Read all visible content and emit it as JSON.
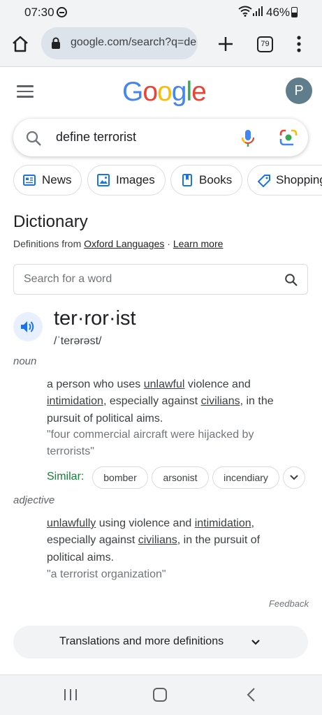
{
  "status_bar": {
    "time": "07:30",
    "battery": "46%",
    "battery_level": 0.46
  },
  "browser": {
    "url": "google.com/search?q=define+terrorist",
    "tab_count": "79"
  },
  "google": {
    "logo_letters": [
      {
        "ch": "G",
        "color": "#4285f4"
      },
      {
        "ch": "o",
        "color": "#ea4335"
      },
      {
        "ch": "o",
        "color": "#fbbc05"
      },
      {
        "ch": "g",
        "color": "#4285f4"
      },
      {
        "ch": "l",
        "color": "#34a853"
      },
      {
        "ch": "e",
        "color": "#ea4335"
      }
    ],
    "avatar_letter": "P"
  },
  "search": {
    "query": "define terrorist"
  },
  "chips": [
    {
      "label": "News",
      "icon": "news-icon"
    },
    {
      "label": "Images",
      "icon": "image-icon"
    },
    {
      "label": "Books",
      "icon": "book-icon"
    },
    {
      "label": "Shopping",
      "icon": "tag-icon"
    }
  ],
  "dictionary": {
    "title": "Dictionary",
    "defs_prefix": "Definitions from ",
    "source": "Oxford Languages",
    "separator": " · ",
    "learn_more": "Learn more",
    "word_search_placeholder": "Search for a word",
    "headword": "ter·ror·ist",
    "phonetic": "/ˈterərəst/",
    "senses": [
      {
        "pos": "noun",
        "definition_parts": [
          {
            "text": "a person who uses ",
            "link": false
          },
          {
            "text": "unlawful",
            "link": true
          },
          {
            "text": " violence and ",
            "link": false
          },
          {
            "text": "intimidation",
            "link": true
          },
          {
            "text": ", especially against ",
            "link": false
          },
          {
            "text": "civilians",
            "link": true
          },
          {
            "text": ", in the pursuit of political aims.",
            "link": false
          }
        ],
        "example": "\"four commercial aircraft were hijacked by terrorists\""
      },
      {
        "pos": "adjective",
        "definition_parts": [
          {
            "text": "unlawfully",
            "link": true
          },
          {
            "text": " using violence and ",
            "link": false
          },
          {
            "text": "intimidation",
            "link": true
          },
          {
            "text": ", especially against ",
            "link": false
          },
          {
            "text": "civilians",
            "link": true
          },
          {
            "text": ", in the pursuit of political aims.",
            "link": false
          }
        ],
        "example": "\"a terrorist organization\""
      }
    ],
    "similar_label": "Similar:",
    "similar": [
      "bomber",
      "arsonist",
      "incendiary"
    ],
    "feedback": "Feedback",
    "translations_button": "Translations and more definitions"
  }
}
